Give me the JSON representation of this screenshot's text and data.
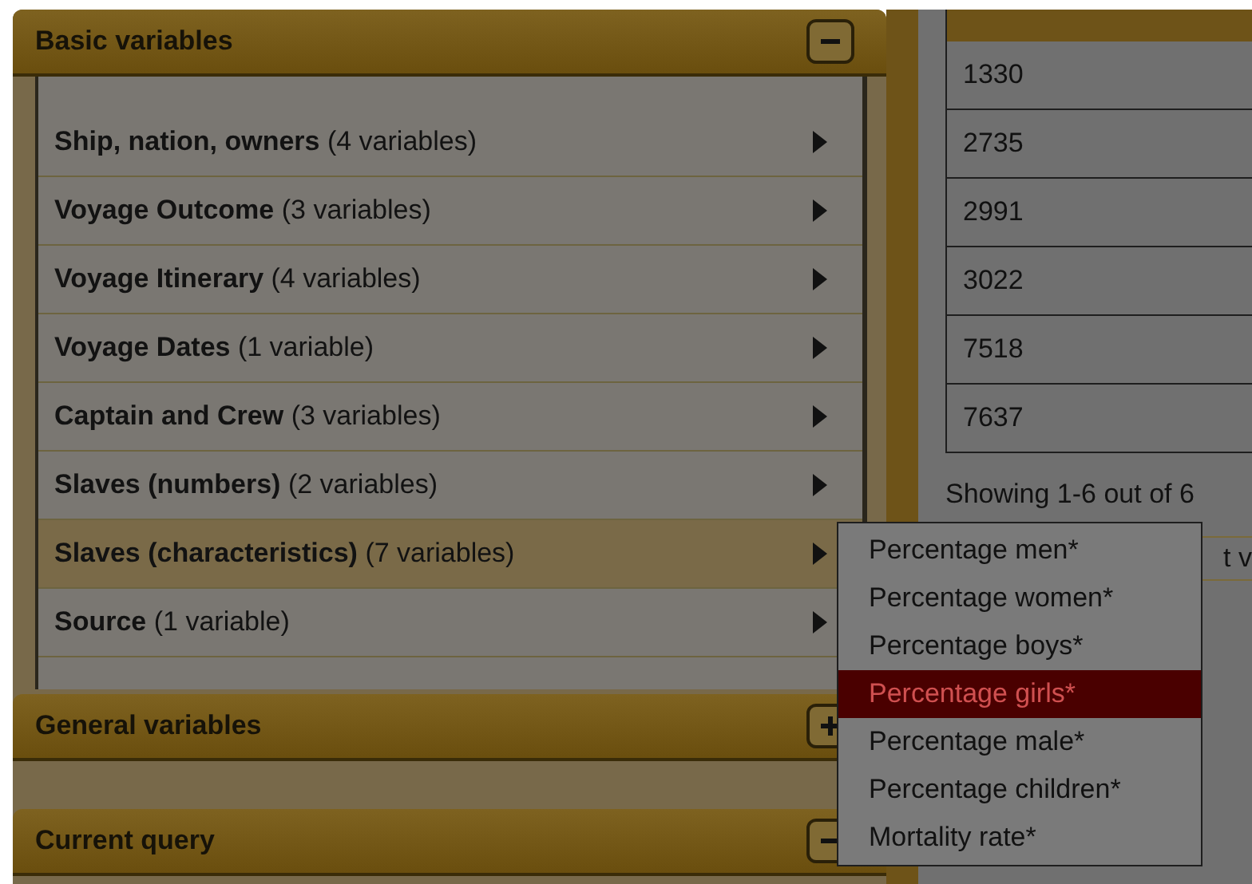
{
  "sections": [
    {
      "title": "Basic variables",
      "expanded": true,
      "items": [
        {
          "name": "Ship, nation, owners",
          "count": "(4 variables)",
          "highlighted": false
        },
        {
          "name": "Voyage Outcome",
          "count": "(3 variables)",
          "highlighted": false
        },
        {
          "name": "Voyage Itinerary",
          "count": "(4 variables)",
          "highlighted": false
        },
        {
          "name": "Voyage Dates",
          "count": "(1 variable)",
          "highlighted": false
        },
        {
          "name": "Captain and Crew",
          "count": "(3 variables)",
          "highlighted": false
        },
        {
          "name": "Slaves (numbers)",
          "count": "(2 variables)",
          "highlighted": false
        },
        {
          "name": "Slaves (characteristics)",
          "count": "(7 variables)",
          "highlighted": true
        },
        {
          "name": "Source",
          "count": "(1 variable)",
          "highlighted": false
        }
      ]
    },
    {
      "title": "General variables",
      "expanded": false
    },
    {
      "title": "Current query",
      "expanded": true
    }
  ],
  "table": {
    "rows": [
      "1330",
      "2735",
      "2991",
      "3022",
      "7518",
      "7637"
    ]
  },
  "status": "Showing 1-6 out of 6",
  "field_fragment": "t v",
  "submenu": [
    {
      "label": "Percentage men*",
      "highlighted": false
    },
    {
      "label": "Percentage women*",
      "highlighted": false
    },
    {
      "label": "Percentage boys*",
      "highlighted": false
    },
    {
      "label": "Percentage girls*",
      "highlighted": true
    },
    {
      "label": "Percentage male*",
      "highlighted": false
    },
    {
      "label": "Percentage children*",
      "highlighted": false
    },
    {
      "label": "Mortality rate*",
      "highlighted": false
    }
  ]
}
